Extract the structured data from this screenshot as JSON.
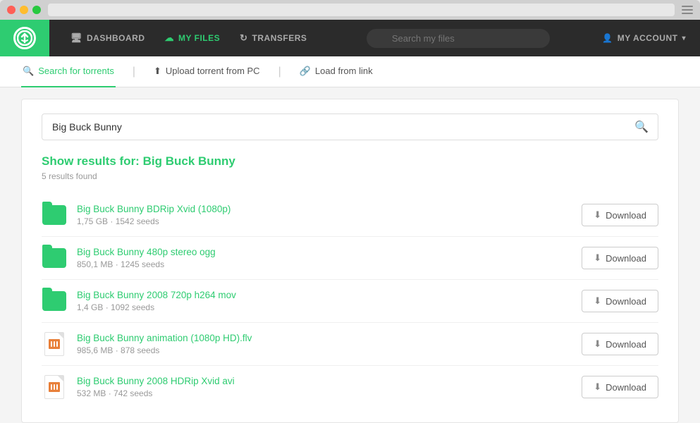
{
  "window": {
    "traffic": [
      "red",
      "yellow",
      "green"
    ]
  },
  "navbar": {
    "logo_symbol": "⚓",
    "nav_items": [
      {
        "id": "dashboard",
        "label": "DASHBOARD",
        "icon": "🖥",
        "active": false
      },
      {
        "id": "my-files",
        "label": "MY FILES",
        "icon": "☁",
        "active": false,
        "green": true
      },
      {
        "id": "transfers",
        "label": "TRANSFERS",
        "icon": "↻",
        "active": false
      }
    ],
    "search_placeholder": "Search my files",
    "account_label": "MY ACCOUNT"
  },
  "tabs": [
    {
      "id": "search-torrents",
      "label": "Search for torrents",
      "active": true
    },
    {
      "id": "upload-torrent",
      "label": "Upload torrent from PC",
      "active": false
    },
    {
      "id": "load-from-link",
      "label": "Load from link",
      "active": false
    }
  ],
  "search": {
    "query": "Big Buck Bunny",
    "placeholder": "Big Buck Bunny"
  },
  "results": {
    "heading_prefix": "Show results for:",
    "query_highlight": "Big Buck Bunny",
    "count_label": "5 results found",
    "download_label": "Download",
    "items": [
      {
        "id": 1,
        "title": "Big Buck Bunny BDRip Xvid (1080p)",
        "size": "1,75 GB",
        "seeds": "1542 seeds",
        "type": "folder"
      },
      {
        "id": 2,
        "title": "Big Buck Bunny 480p stereo ogg",
        "size": "850,1 MB",
        "seeds": "1245 seeds",
        "type": "folder"
      },
      {
        "id": 3,
        "title": "Big Buck Bunny 2008 720p h264 mov",
        "size": "1,4 GB",
        "seeds": "1092 seeds",
        "type": "folder"
      },
      {
        "id": 4,
        "title": "Big Buck Bunny animation (1080p HD).flv",
        "size": "985,6 MB",
        "seeds": "878 seeds",
        "type": "video"
      },
      {
        "id": 5,
        "title": "Big Buck Bunny 2008 HDRip Xvid avi",
        "size": "532 MB",
        "seeds": "742 seeds",
        "type": "video"
      }
    ]
  }
}
